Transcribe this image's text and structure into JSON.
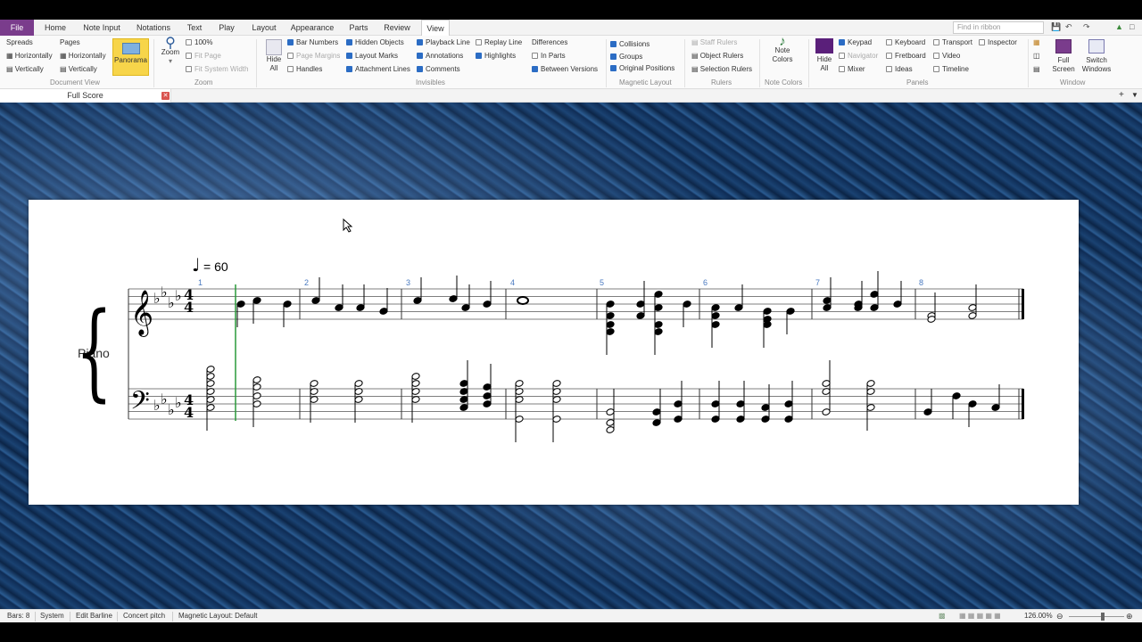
{
  "tabs": [
    "File",
    "Home",
    "Note Input",
    "Notations",
    "Text",
    "Play",
    "Layout",
    "Appearance",
    "Parts",
    "Review",
    "View"
  ],
  "find_placeholder": "Find in ribbon",
  "ribbon": {
    "document_view": {
      "group": "Document View",
      "spreads": "Spreads",
      "pages": "Pages",
      "h1": "Horizontally",
      "v1": "Vertically",
      "h2": "Horizontally",
      "v2": "Vertically",
      "panorama": "Panorama"
    },
    "zoom": {
      "group": "Zoom",
      "zoom_label": "Zoom",
      "p100": "100%",
      "fit_page": "Fit Page",
      "fit_system": "Fit System Width"
    },
    "invisibles": {
      "group": "Invisibles",
      "hide_all": "Hide All",
      "items": [
        "Bar Numbers",
        "Page Margins",
        "Handles",
        "Hidden Objects",
        "Layout Marks",
        "Attachment Lines",
        "Playback Line",
        "Annotations",
        "Comments",
        "Replay Line",
        "Highlights"
      ]
    },
    "differences": {
      "label": "Differences",
      "in_parts": "In Parts",
      "between_versions": "Between Versions"
    },
    "magnetic": {
      "group": "Magnetic Layout",
      "items": [
        "Collisions",
        "Groups",
        "Original Positions"
      ]
    },
    "rulers": {
      "group": "Rulers",
      "items": [
        "Staff Rulers",
        "Object Rulers",
        "Selection Rulers"
      ]
    },
    "note_colors": {
      "group": "Note Colors",
      "label": "Note Colors"
    },
    "panels": {
      "group": "Panels",
      "hide_all": "Hide All",
      "items": [
        "Keypad",
        "Navigator",
        "Mixer",
        "Keyboard",
        "Fretboard",
        "Ideas",
        "Transport",
        "Video",
        "Timeline",
        "Inspector"
      ]
    },
    "window": {
      "group": "Window",
      "full_screen": "Full Screen",
      "switch_windows": "Switch Windows"
    }
  },
  "document_tab": "Full Score",
  "score": {
    "tempo": "= 60",
    "instrument": "Piano",
    "bar_numbers": [
      "1",
      "2",
      "3",
      "4",
      "5",
      "6",
      "7",
      "8"
    ],
    "key": "Ab major / F minor (4 flats)",
    "time_signature": "4/4"
  },
  "status": {
    "bars": "Bars: 8",
    "system": "System",
    "edit_barline": "Edit Barline",
    "concert_pitch": "Concert pitch",
    "magnetic_layout": "Magnetic Layout: Default",
    "zoom": "126.00%"
  },
  "colors": {
    "file_tab": "#7a3c8c",
    "panorama_active": "#f7d54a",
    "accent": "#2b6cc4",
    "panel_swatch": "#5a1f7a"
  }
}
